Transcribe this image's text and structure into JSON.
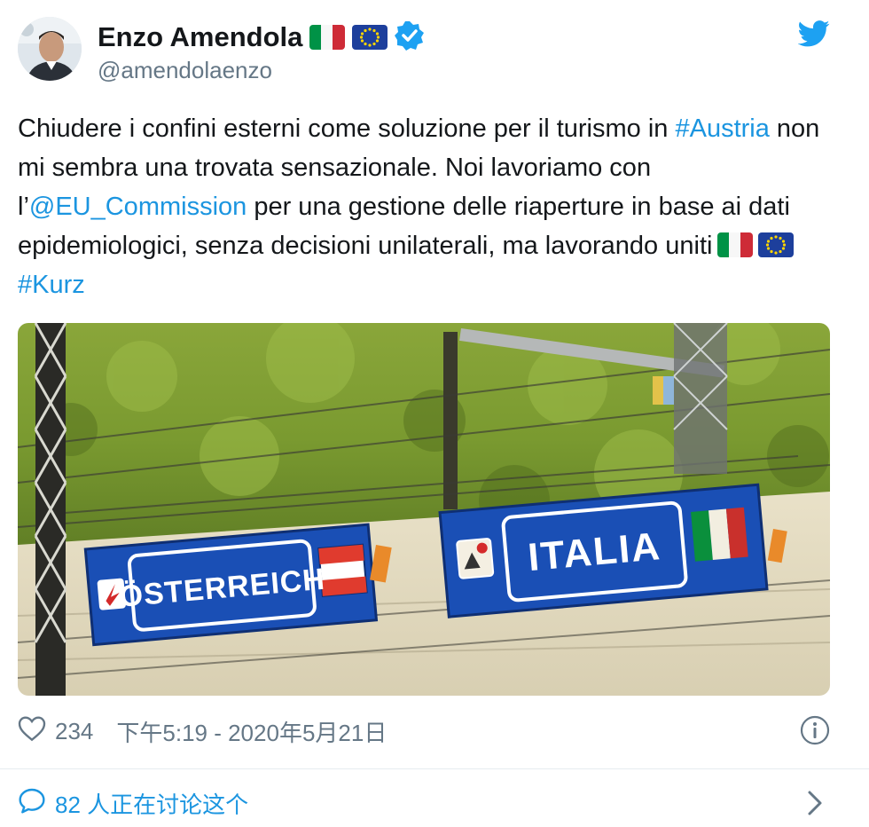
{
  "user": {
    "name": "Enzo Amendola",
    "handle": "@amendolaenzo"
  },
  "tweet": {
    "segments": [
      {
        "text": "Chiudere i confini esterni come soluzione per il turismo in ",
        "type": "text"
      },
      {
        "text": "#Austria",
        "type": "link"
      },
      {
        "text": " non mi sembra una trovata sensazionale. Noi lavoriamo con l’",
        "type": "text"
      },
      {
        "text": "@EU_Commission",
        "type": "link"
      },
      {
        "text": " per una gestione delle riaperture in base ai dati epidemiologici, senza decisioni unilaterali, ma lavorando uniti",
        "type": "text"
      },
      {
        "text": "#Kurz",
        "type": "link"
      }
    ]
  },
  "media": {
    "sign_left": "ÖSTERREICH",
    "sign_right": "ITALIA"
  },
  "meta": {
    "likes": "234",
    "timestamp": "下午5:19 - 2020年5月21日"
  },
  "discussion": {
    "label": "82 人正在讨论这个"
  },
  "icons": [
    "verified-badge-icon",
    "twitter-bird-icon",
    "heart-icon",
    "info-icon",
    "comment-bubble-icon",
    "chevron-right-icon",
    "italy-flag-icon",
    "eu-flag-icon"
  ],
  "colors": {
    "link": "#1b95e0",
    "muted": "#657786",
    "text": "#14171a",
    "sign_blue": "#1a4fb5"
  }
}
